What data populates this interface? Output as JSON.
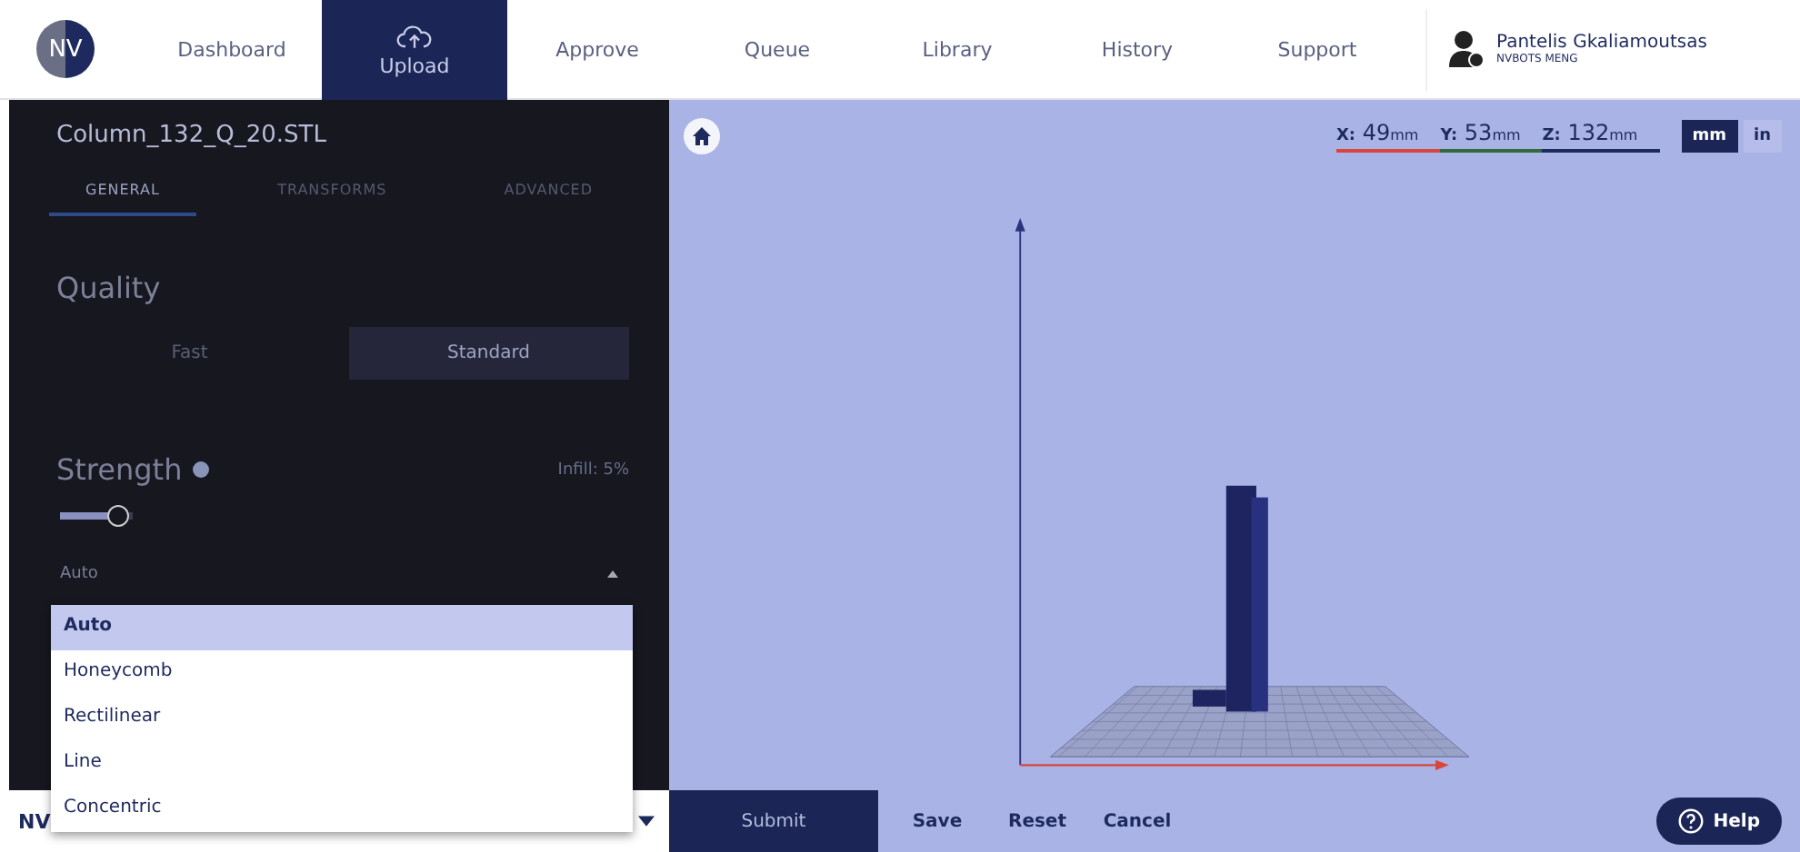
{
  "nav": {
    "logo": "NV",
    "items": [
      {
        "label": "Dashboard",
        "selected": false,
        "icon": false
      },
      {
        "label": "Upload",
        "selected": true,
        "icon": true
      },
      {
        "label": "Approve",
        "selected": false,
        "icon": false
      },
      {
        "label": "Queue",
        "selected": false,
        "icon": false
      },
      {
        "label": "Library",
        "selected": false,
        "icon": false
      },
      {
        "label": "History",
        "selected": false,
        "icon": false
      },
      {
        "label": "Support",
        "selected": false,
        "icon": false
      }
    ],
    "user": {
      "name": "Pantelis Gkaliamoutsas",
      "org": "NVBOTS MENG"
    }
  },
  "panel": {
    "file": "Column_132_Q_20.STL",
    "tabs": [
      {
        "label": "GENERAL",
        "selected": true
      },
      {
        "label": "TRANSFORMS",
        "selected": false
      },
      {
        "label": "ADVANCED",
        "selected": false
      }
    ],
    "quality": {
      "title": "Quality",
      "options": [
        {
          "label": "Fast",
          "selected": false
        },
        {
          "label": "Standard",
          "selected": true
        }
      ]
    },
    "strength": {
      "title": "Strength",
      "infill": "Infill: 5%",
      "level": 0.8
    },
    "pattern": {
      "value": "Auto",
      "options": [
        {
          "label": "Auto",
          "selected": true
        },
        {
          "label": "Honeycomb",
          "selected": false
        },
        {
          "label": "Rectilinear",
          "selected": false
        },
        {
          "label": "Line",
          "selected": false
        },
        {
          "label": "Concentric",
          "selected": false
        }
      ]
    },
    "footer": "NV"
  },
  "viewport": {
    "coords": [
      {
        "axis": "X:",
        "value": "49",
        "unit": "mm",
        "color": "#d9453b"
      },
      {
        "axis": "Y:",
        "value": "53",
        "unit": "mm",
        "color": "#2f6b3a"
      },
      {
        "axis": "Z:",
        "value": "132",
        "unit": "mm",
        "color": "#1e2a5e"
      }
    ],
    "units": [
      {
        "label": "mm",
        "selected": true
      },
      {
        "label": "in",
        "selected": false
      }
    ]
  },
  "actions": [
    {
      "label": "Submit",
      "kind": "primary"
    },
    {
      "label": "Save",
      "kind": "plain"
    },
    {
      "label": "Reset",
      "kind": "plain"
    },
    {
      "label": "Cancel",
      "kind": "plain"
    }
  ],
  "help": "Help"
}
